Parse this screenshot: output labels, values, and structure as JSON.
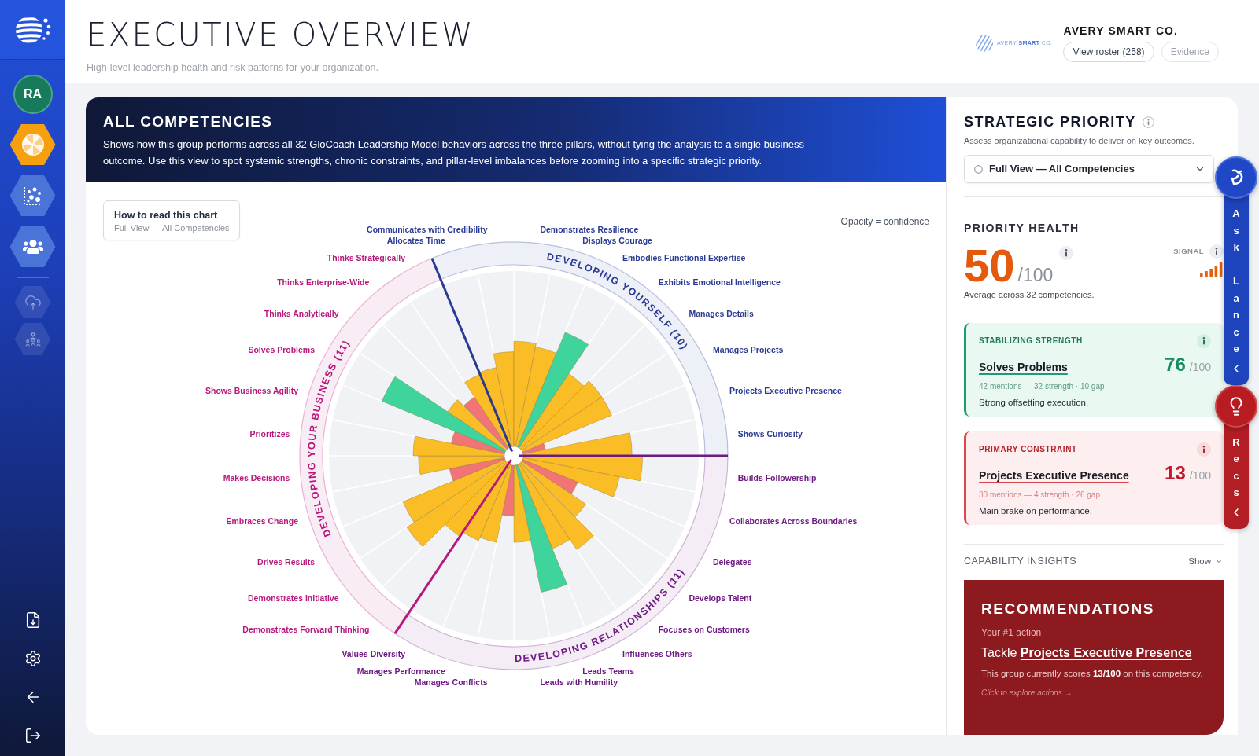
{
  "sidebar": {
    "avatar": "RA",
    "nav": [
      {
        "selected": true
      },
      {
        "selected": false
      },
      {
        "selected": false
      }
    ],
    "tools": [
      {
        "disabled": true
      },
      {
        "disabled": true
      }
    ]
  },
  "header": {
    "title": "EXECUTIVE OVERVIEW",
    "subtitle": "High-level leadership health and risk patterns for your organization.",
    "logo_text": "AVERY **SMART** CO.",
    "company": "AVERY SMART CO.",
    "buttons": [
      {
        "label": "View roster (258)",
        "disabled": false
      },
      {
        "label": "Evidence",
        "disabled": true
      }
    ]
  },
  "overview": {
    "title": "ALL COMPETENCIES",
    "description": "Shows how this group performs across all 32 GloCoach Leadership Model behaviors across the three pillars, without tying the analysis to a single business outcome. Use this view to spot systemic strengths, chronic constraints, and pillar-level imbalances before zooming into a specific strategic priority.",
    "guide": {
      "title": "How to read this chart",
      "subtitle": "Full View — All Competencies"
    },
    "note": "Opacity = confidence",
    "wheel": {
      "pillars": [
        {
          "label": "DEVELOPING YOURSELF (10)",
          "color": "#2a3a93"
        },
        {
          "label": "DEVELOPING RELATIONSHIPS (11)",
          "color": "#6e1a84"
        },
        {
          "label": "DEVELOPING YOUR BUSINESS (11)",
          "color": "#b8177c"
        }
      ],
      "labels_left": [
        {
          "name": "Communicates with Credibility",
          "color": "#2a3a93"
        },
        {
          "name": "Allocates Time",
          "color": "#2a3a93"
        },
        {
          "name": "Thinks Strategically",
          "color": "#b8177c"
        },
        {
          "name": "Thinks Enterprise-Wide",
          "color": "#b8177c"
        },
        {
          "name": "Thinks Analytically",
          "color": "#b8177c"
        },
        {
          "name": "Solves Problems",
          "color": "#b8177c"
        },
        {
          "name": "Shows Business Agility",
          "color": "#b8177c"
        },
        {
          "name": "Prioritizes",
          "color": "#b8177c"
        },
        {
          "name": "Makes Decisions",
          "color": "#b8177c"
        },
        {
          "name": "Embraces Change",
          "color": "#b8177c"
        },
        {
          "name": "Drives Results",
          "color": "#b8177c"
        },
        {
          "name": "Demonstrates Initiative",
          "color": "#b8177c"
        },
        {
          "name": "Demonstrates Forward Thinking",
          "color": "#b8177c"
        },
        {
          "name": "Values Diversity",
          "color": "#6e1a84"
        },
        {
          "name": "Manages Performance",
          "color": "#6e1a84"
        },
        {
          "name": "Manages Conflicts",
          "color": "#6e1a84"
        }
      ],
      "labels_right": [
        {
          "name": "Demonstrates Resilience",
          "color": "#2a3a93"
        },
        {
          "name": "Displays Courage",
          "color": "#2a3a93"
        },
        {
          "name": "Embodies Functional Expertise",
          "color": "#2a3a93"
        },
        {
          "name": "Exhibits Emotional Intelligence",
          "color": "#2a3a93"
        },
        {
          "name": "Manages Details",
          "color": "#2a3a93"
        },
        {
          "name": "Manages Projects",
          "color": "#2a3a93"
        },
        {
          "name": "Projects Executive Presence",
          "color": "#2a3a93"
        },
        {
          "name": "Shows Curiosity",
          "color": "#2a3a93"
        },
        {
          "name": "Builds Followership",
          "color": "#6e1a84"
        },
        {
          "name": "Collaborates Across Boundaries",
          "color": "#6e1a84"
        },
        {
          "name": "Delegates",
          "color": "#6e1a84"
        },
        {
          "name": "Develops Talent",
          "color": "#6e1a84"
        },
        {
          "name": "Focuses on Customers",
          "color": "#6e1a84"
        },
        {
          "name": "Influences Others",
          "color": "#6e1a84"
        },
        {
          "name": "Leads Teams",
          "color": "#6e1a84"
        },
        {
          "name": "Leads with Humility",
          "color": "#6e1a84"
        }
      ]
    }
  },
  "priority": {
    "title": "STRATEGIC PRIORITY",
    "subtitle": "Assess organizational capability to deliver on key outcomes.",
    "select": {
      "value": "Full View — All Competencies"
    },
    "health": {
      "title": "PRIORITY HEALTH",
      "score": "50",
      "out_of": "/100",
      "signal_label": "SIGNAL",
      "caption": "Average across 32 competencies."
    },
    "cards": [
      {
        "kind": "strength",
        "label": "STABILIZING STRENGTH",
        "name": "Solves Problems",
        "score": "76",
        "out_of": "/100",
        "stats": "42 mentions — 32 strength · 10 gap",
        "note": "Strong offsetting execution."
      },
      {
        "kind": "constraint",
        "label": "PRIMARY CONSTRAINT",
        "name": "Projects Executive Presence",
        "score": "13",
        "out_of": "/100",
        "stats": "30 mentions — 4 strength · 26 gap",
        "note": "Main brake on performance."
      }
    ],
    "insights": {
      "title": "CAPABILITY INSIGHTS",
      "toggle": "Show",
      "expanded": false
    },
    "recommendations": {
      "title": "RECOMMENDATIONS",
      "eyebrow": "Your #1 action",
      "action": "Tackle **Projects Executive Presence**",
      "detail": "This group currently scores **13/100** on this competency.",
      "link": "Click to explore actions →"
    }
  },
  "floating": [
    {
      "kind": "ask",
      "label": "Ask Lance"
    },
    {
      "kind": "recs",
      "label": "Recs"
    }
  ]
}
